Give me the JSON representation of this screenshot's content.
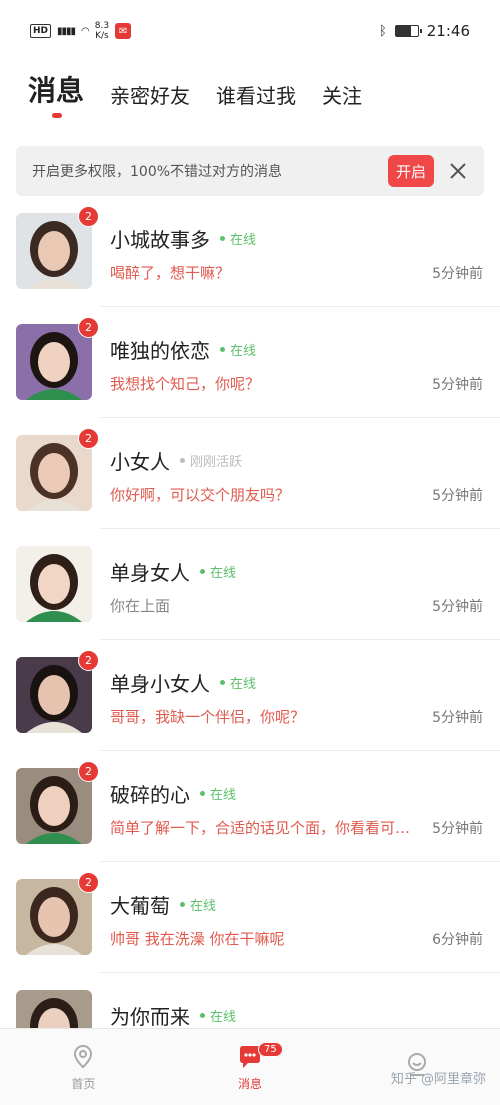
{
  "status_bar": {
    "hd": "HD",
    "signal": "5G",
    "speed_value": "8.3",
    "speed_unit": "K/s",
    "time": "21:46",
    "battery_level": 0.7
  },
  "tabs": [
    {
      "label": "消息",
      "active": true
    },
    {
      "label": "亲密好友",
      "active": false
    },
    {
      "label": "谁看过我",
      "active": false
    },
    {
      "label": "关注",
      "active": false
    }
  ],
  "banner": {
    "text": "开启更多权限，100%不错过对方的消息",
    "button_label": "开启"
  },
  "conversations": [
    {
      "name": "小城故事多",
      "presence": "在线",
      "online": true,
      "message": "喝醉了，想干嘛？",
      "time": "5分钟前",
      "unread": "2",
      "msg_color": "#e05a4f"
    },
    {
      "name": "唯独的依恋",
      "presence": "在线",
      "online": true,
      "message": "我想找个知己，你呢？",
      "time": "5分钟前",
      "unread": "2",
      "msg_color": "#e05a4f"
    },
    {
      "name": "小女人",
      "presence": "刚刚活跃",
      "online": false,
      "message": "你好啊，可以交个朋友吗？",
      "time": "5分钟前",
      "unread": "2",
      "msg_color": "#e05a4f"
    },
    {
      "name": "单身女人",
      "presence": "在线",
      "online": true,
      "message": "你在上面",
      "time": "5分钟前",
      "unread": "",
      "msg_color": "#888888"
    },
    {
      "name": "单身小女人",
      "presence": "在线",
      "online": true,
      "message": "哥哥，我缺一个伴侣，你呢？",
      "time": "5分钟前",
      "unread": "2",
      "msg_color": "#e05a4f"
    },
    {
      "name": "破碎的心",
      "presence": "在线",
      "online": true,
      "message": "简单了解一下，合适的话见个面，你看看可以吗",
      "time": "5分钟前",
      "unread": "2",
      "msg_color": "#e05a4f"
    },
    {
      "name": "大葡萄",
      "presence": "在线",
      "online": true,
      "message": "帅哥 我在洗澡 你在干嘛呢",
      "time": "6分钟前",
      "unread": "2",
      "msg_color": "#e05a4f"
    },
    {
      "name": "为你而来",
      "presence": "在线",
      "online": true,
      "message": "",
      "time": "",
      "unread": "",
      "msg_color": "#e05a4f"
    }
  ],
  "bottom_nav": [
    {
      "label": "首页",
      "icon": "location-pin-icon",
      "active": false
    },
    {
      "label": "消息",
      "icon": "chat-bubble-icon",
      "active": true,
      "badge": "75"
    },
    {
      "label": "",
      "icon": "profile-icon",
      "active": false
    }
  ],
  "watermark": "知乎 @阿里章弥",
  "colors": {
    "accent": "#e53935",
    "online": "#5cc06b",
    "inactive": "#bbbbbb"
  }
}
